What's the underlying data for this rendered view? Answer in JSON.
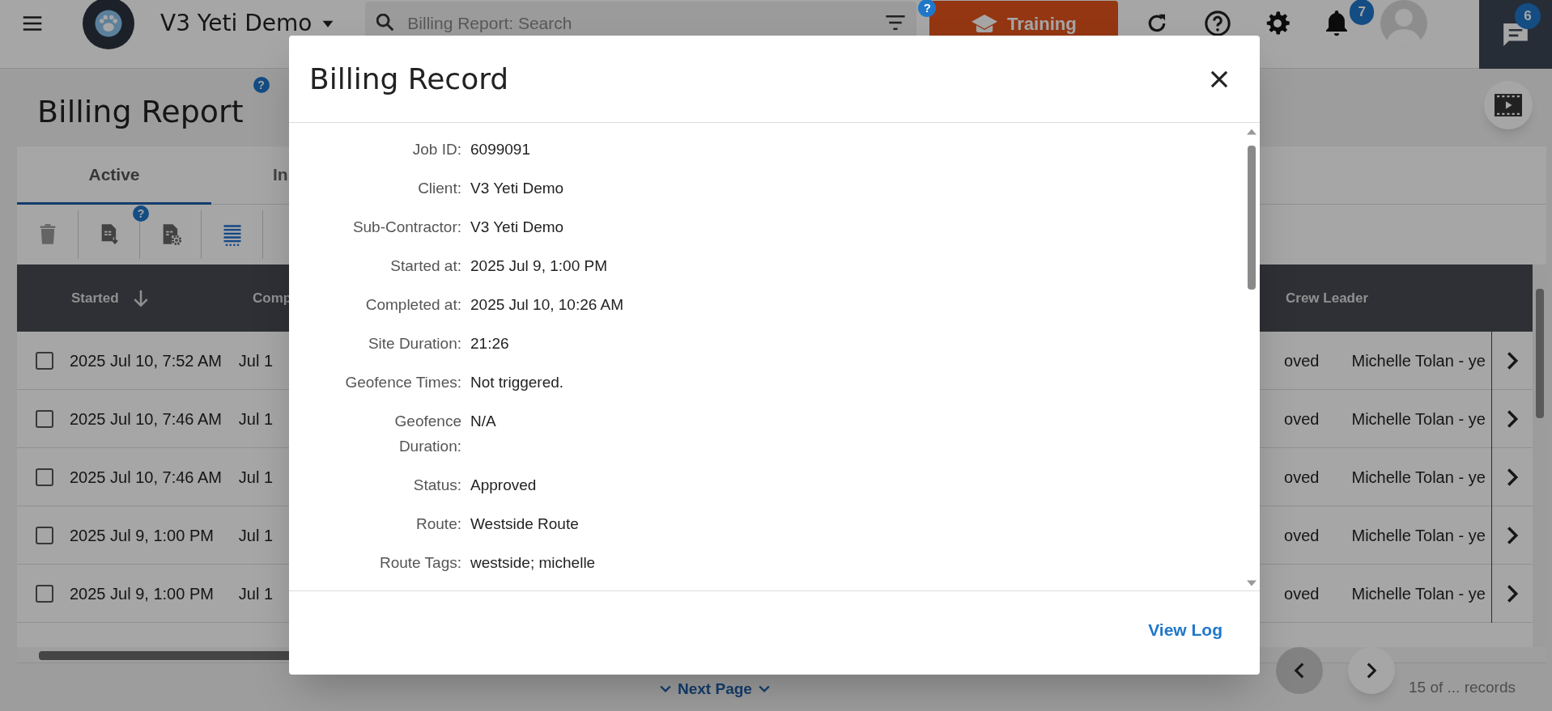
{
  "top_bar": {
    "company": "V3 Yeti Demo",
    "search": {
      "placeholder": "Billing Report: Search"
    },
    "help_badge": "?",
    "training_button": "Training",
    "notification_count": "7",
    "chat_count": "6"
  },
  "page": {
    "title": "Billing Report",
    "help_badge": "?"
  },
  "tabs": [
    {
      "label": "Active",
      "selected": true
    },
    {
      "label": "In",
      "selected": false
    }
  ],
  "toolbar": [
    {
      "kind": "delete",
      "disabled": true
    },
    {
      "kind": "export",
      "disabled": false,
      "badge": "?"
    },
    {
      "kind": "export_settings",
      "disabled": false
    },
    {
      "kind": "columns",
      "disabled": false
    }
  ],
  "table": {
    "columns": [
      {
        "label": "Started",
        "sorted": true
      },
      {
        "label": "Comp"
      },
      {
        "label": "Crew Leader",
        "sorted": false
      }
    ],
    "rows": [
      {
        "checked": false,
        "started": "2025 Jul 10, 7:52 AM",
        "completed": "Jul 1",
        "status": "oved",
        "crew_leader": "Michelle Tolan - ye"
      },
      {
        "checked": false,
        "started": "2025 Jul 10, 7:46 AM",
        "completed": "Jul 1",
        "status": "oved",
        "crew_leader": "Michelle Tolan - ye"
      },
      {
        "checked": false,
        "started": "2025 Jul 10, 7:46 AM",
        "completed": "Jul 1",
        "status": "oved",
        "crew_leader": "Michelle Tolan - ye"
      },
      {
        "checked": false,
        "started": "2025 Jul 9, 1:00 PM",
        "completed": "Jul 1",
        "status": "oved",
        "crew_leader": "Michelle Tolan - ye"
      },
      {
        "checked": false,
        "started": "2025 Jul 9, 1:00 PM",
        "completed": "Jul 1",
        "status": "oved",
        "crew_leader": "Michelle Tolan - ye"
      }
    ]
  },
  "pager": {
    "next_page": "Next Page",
    "records": "15 of ... records"
  },
  "modal": {
    "title": "Billing Record",
    "fields": [
      {
        "label": "Job ID:",
        "value": "6099091"
      },
      {
        "label": "Client:",
        "value": "V3 Yeti Demo"
      },
      {
        "label": "Sub-Contractor:",
        "value": "V3 Yeti Demo"
      },
      {
        "label": "Started at:",
        "value": "2025 Jul 9, 1:00 PM"
      },
      {
        "label": "Completed at:",
        "value": "2025 Jul 10, 10:26 AM"
      },
      {
        "label": "Site Duration:",
        "value": "21:26"
      },
      {
        "label": "Geofence Times:",
        "value": "Not triggered."
      },
      {
        "label": "Geofence Duration:",
        "value": "N/A"
      },
      {
        "label": "Status:",
        "value": "Approved"
      },
      {
        "label": "Route:",
        "value": "Westside Route"
      },
      {
        "label": "Route Tags:",
        "value": "westside; michelle"
      }
    ],
    "link": "View Log"
  }
}
